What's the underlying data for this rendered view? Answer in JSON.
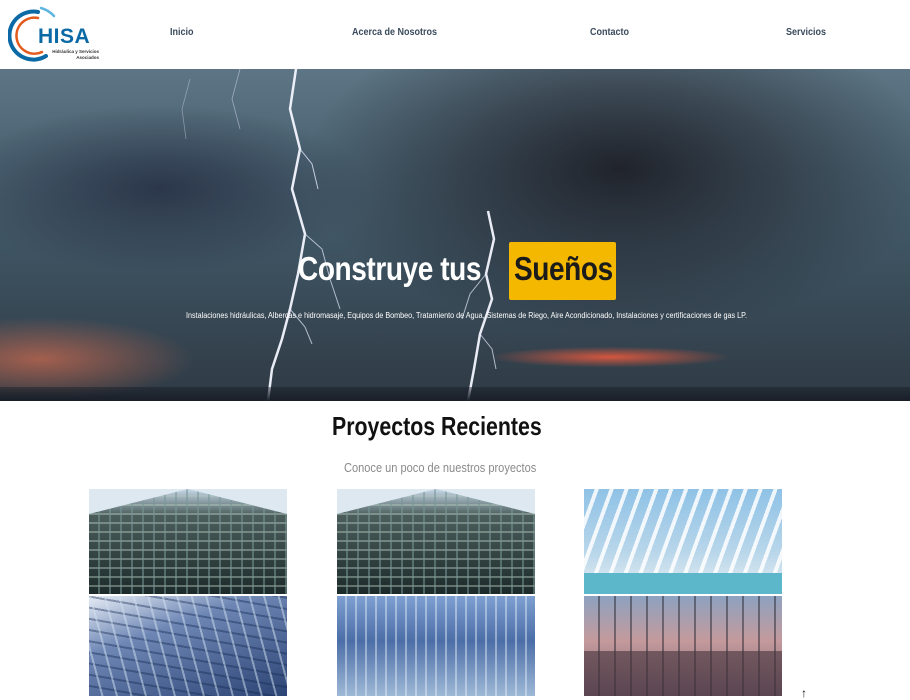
{
  "logo": {
    "name": "HISA",
    "subtitle": "Hidráulica y Servicios Asociados"
  },
  "nav": {
    "items": [
      {
        "label": "Inicio"
      },
      {
        "label": "Acerca de Nosotros"
      },
      {
        "label": "Contacto"
      },
      {
        "label": "Servicios"
      }
    ]
  },
  "hero": {
    "title": "Construye tus",
    "highlight": "Sueños",
    "highlight_color": "#f5b800",
    "subtitle": "Instalaciones hidráulicas, Albercas e hidromasaje, Equipos de Bombeo, Tratamiento de Agua, Sistemas de Riego, Aire Acondicionado, Instalaciones y certificaciones de gas LP."
  },
  "projects": {
    "title": "Proyectos Recientes",
    "subtitle": "Conoce un poco de nuestros proyectos",
    "images": [
      {
        "icon": "building-facade-image"
      },
      {
        "icon": "building-facade-image"
      },
      {
        "icon": "bridge-structure-image"
      },
      {
        "icon": "glass-building-image"
      },
      {
        "icon": "glass-tower-image"
      },
      {
        "icon": "port-city-image"
      }
    ]
  },
  "scroll": {
    "icon": "scroll-up-arrow-icon",
    "glyph": "↑"
  },
  "colors": {
    "brand_blue": "#0b6aa5",
    "nav_text": "#3a4a5c",
    "accent_yellow": "#f5b800"
  }
}
